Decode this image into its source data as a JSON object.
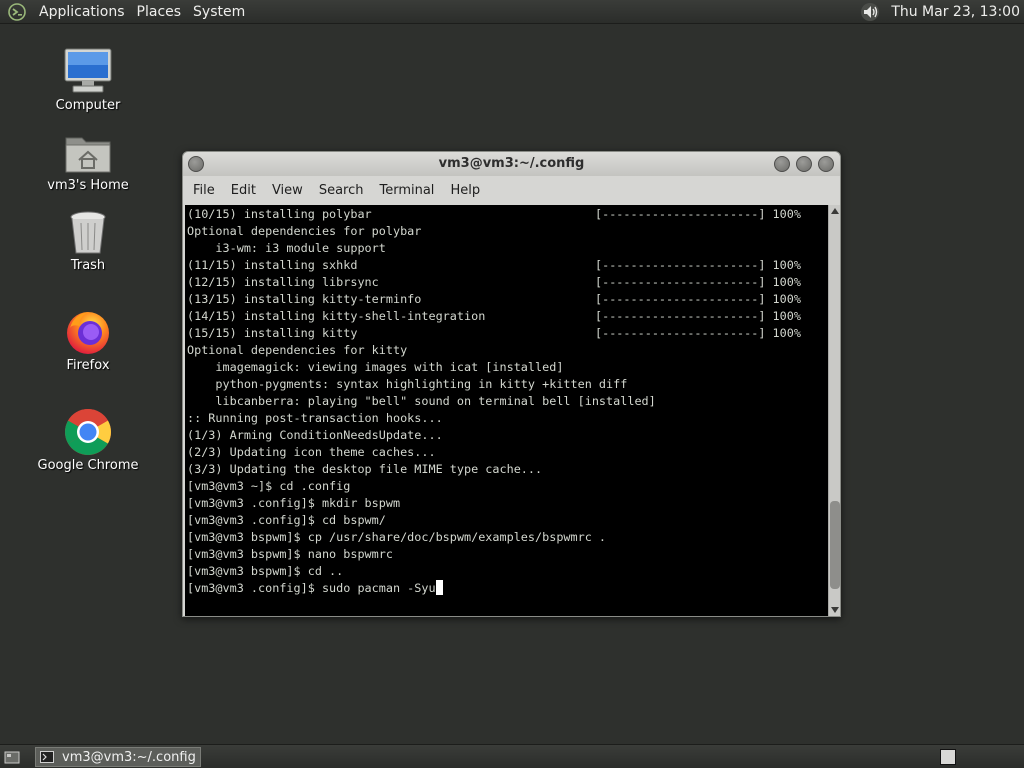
{
  "top_panel": {
    "menus": [
      "Applications",
      "Places",
      "System"
    ],
    "clock": "Thu Mar 23, 13:00",
    "icons": {
      "logo": "mate-logo-icon",
      "volume": "volume-icon"
    }
  },
  "desktop": {
    "icons": [
      {
        "label": "Computer",
        "icon": "computer-icon"
      },
      {
        "label": "vm3's Home",
        "icon": "home-folder-icon"
      },
      {
        "label": "Trash",
        "icon": "trash-icon"
      },
      {
        "label": "Firefox",
        "icon": "firefox-icon"
      },
      {
        "label": "Google Chrome",
        "icon": "chrome-icon"
      }
    ]
  },
  "window": {
    "title": "vm3@vm3:~/.config",
    "menus": [
      "File",
      "Edit",
      "View",
      "Search",
      "Terminal",
      "Help"
    ],
    "terminal_lines": [
      {
        "text": "(10/15) installing polybar",
        "progress": "[----------------------] 100%"
      },
      {
        "text": "Optional dependencies for polybar",
        "progress": ""
      },
      {
        "text": "    i3-wm: i3 module support",
        "progress": ""
      },
      {
        "text": "(11/15) installing sxhkd",
        "progress": "[----------------------] 100%"
      },
      {
        "text": "(12/15) installing librsync",
        "progress": "[----------------------] 100%"
      },
      {
        "text": "(13/15) installing kitty-terminfo",
        "progress": "[----------------------] 100%"
      },
      {
        "text": "(14/15) installing kitty-shell-integration",
        "progress": "[----------------------] 100%"
      },
      {
        "text": "(15/15) installing kitty",
        "progress": "[----------------------] 100%"
      },
      {
        "text": "Optional dependencies for kitty",
        "progress": ""
      },
      {
        "text": "    imagemagick: viewing images with icat [installed]",
        "progress": ""
      },
      {
        "text": "    python-pygments: syntax highlighting in kitty +kitten diff",
        "progress": ""
      },
      {
        "text": "    libcanberra: playing \"bell\" sound on terminal bell [installed]",
        "progress": ""
      },
      {
        "text": ":: Running post-transaction hooks...",
        "progress": ""
      },
      {
        "text": "(1/3) Arming ConditionNeedsUpdate...",
        "progress": ""
      },
      {
        "text": "(2/3) Updating icon theme caches...",
        "progress": ""
      },
      {
        "text": "(3/3) Updating the desktop file MIME type cache...",
        "progress": ""
      },
      {
        "text": "[vm3@vm3 ~]$ cd .config",
        "progress": ""
      },
      {
        "text": "[vm3@vm3 .config]$ mkdir bspwm",
        "progress": ""
      },
      {
        "text": "[vm3@vm3 .config]$ cd bspwm/",
        "progress": ""
      },
      {
        "text": "[vm3@vm3 bspwm]$ cp /usr/share/doc/bspwm/examples/bspwmrc .",
        "progress": ""
      },
      {
        "text": "[vm3@vm3 bspwm]$ nano bspwmrc",
        "progress": ""
      },
      {
        "text": "[vm3@vm3 bspwm]$ cd ..",
        "progress": ""
      }
    ],
    "prompt_line": "[vm3@vm3 .config]$ sudo pacman -Syu",
    "scroll_position": 0.95
  },
  "bottom_panel": {
    "task_label": "vm3@vm3:~/.config",
    "icons": {
      "show_desktop": "show-desktop-icon",
      "task": "terminal-icon",
      "workspace": "workspace-switcher-icon"
    }
  }
}
